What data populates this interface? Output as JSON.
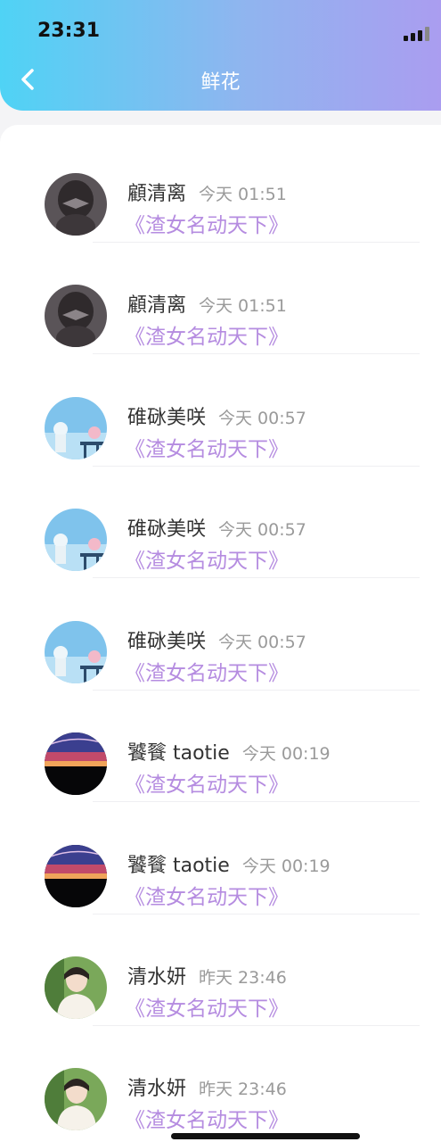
{
  "status_bar": {
    "time": "23:31"
  },
  "header": {
    "title": "鲜花"
  },
  "records": [
    {
      "name": "顧清离",
      "time": "今天 01:51",
      "work": "《渣女名动天下》",
      "avatar": "avatar-dark-girl"
    },
    {
      "name": "顧清离",
      "time": "今天 01:51",
      "work": "《渣女名动天下》",
      "avatar": "avatar-dark-girl"
    },
    {
      "name": "碓砯美咲",
      "time": "今天 00:57",
      "work": "《渣女名动天下》",
      "avatar": "avatar-sky-girl"
    },
    {
      "name": "碓砯美咲",
      "time": "今天 00:57",
      "work": "《渣女名动天下》",
      "avatar": "avatar-sky-girl"
    },
    {
      "name": "碓砯美咲",
      "time": "今天 00:57",
      "work": "《渣女名动天下》",
      "avatar": "avatar-sky-girl"
    },
    {
      "name": "饕餮 taotie",
      "time": "今天 00:19",
      "work": "《渣女名动天下》",
      "avatar": "avatar-night-sky"
    },
    {
      "name": "饕餮 taotie",
      "time": "今天 00:19",
      "work": "《渣女名动天下》",
      "avatar": "avatar-night-sky"
    },
    {
      "name": "清水妍",
      "time": "昨天 23:46",
      "work": "《渣女名动天下》",
      "avatar": "avatar-boy"
    },
    {
      "name": "清水妍",
      "time": "昨天 23:46",
      "work": "《渣女名动天下》",
      "avatar": "avatar-boy"
    }
  ],
  "colors": {
    "header_gradient": [
      "#4fd3f5",
      "#aa9df0"
    ],
    "work_link": "#b58ce0",
    "time_text": "#9a9a9a"
  }
}
